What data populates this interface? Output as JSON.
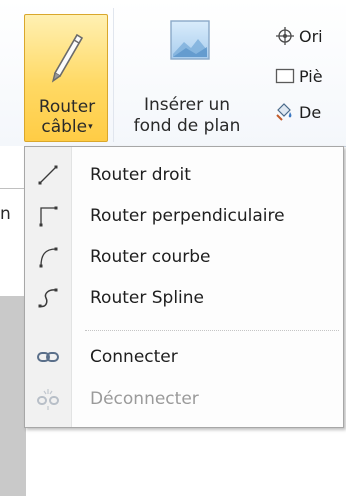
{
  "ribbon": {
    "router_button": {
      "line1": "Router",
      "line2": "câble",
      "caret": "▾",
      "icon": "pencil-icon"
    },
    "insert_button": {
      "line1": "Insérer un",
      "line2": "fond de plan",
      "icon": "picture-icon"
    },
    "small_commands": [
      {
        "label": "Ori",
        "icon": "crosshair-icon"
      },
      {
        "label": "Piè",
        "icon": "frame-icon"
      },
      {
        "label": "De",
        "icon": "paint-icon"
      }
    ]
  },
  "left_fragment": "n",
  "menu": {
    "items": [
      {
        "label": "Router droit",
        "icon": "straight-line-icon",
        "enabled": true
      },
      {
        "label": "Router perpendiculaire",
        "icon": "orthogonal-line-icon",
        "enabled": true
      },
      {
        "label": "Router courbe",
        "icon": "curve-line-icon",
        "enabled": true
      },
      {
        "label": "Router Spline",
        "icon": "spline-icon",
        "enabled": true
      },
      {
        "label": "Connecter",
        "icon": "link-icon",
        "enabled": true
      },
      {
        "label": "Déconnecter",
        "icon": "unlink-icon",
        "enabled": false
      }
    ]
  },
  "colors": {
    "selected_button": "#ffd964",
    "selected_border": "#d9a72c",
    "disabled_text": "#9a9a9a"
  }
}
